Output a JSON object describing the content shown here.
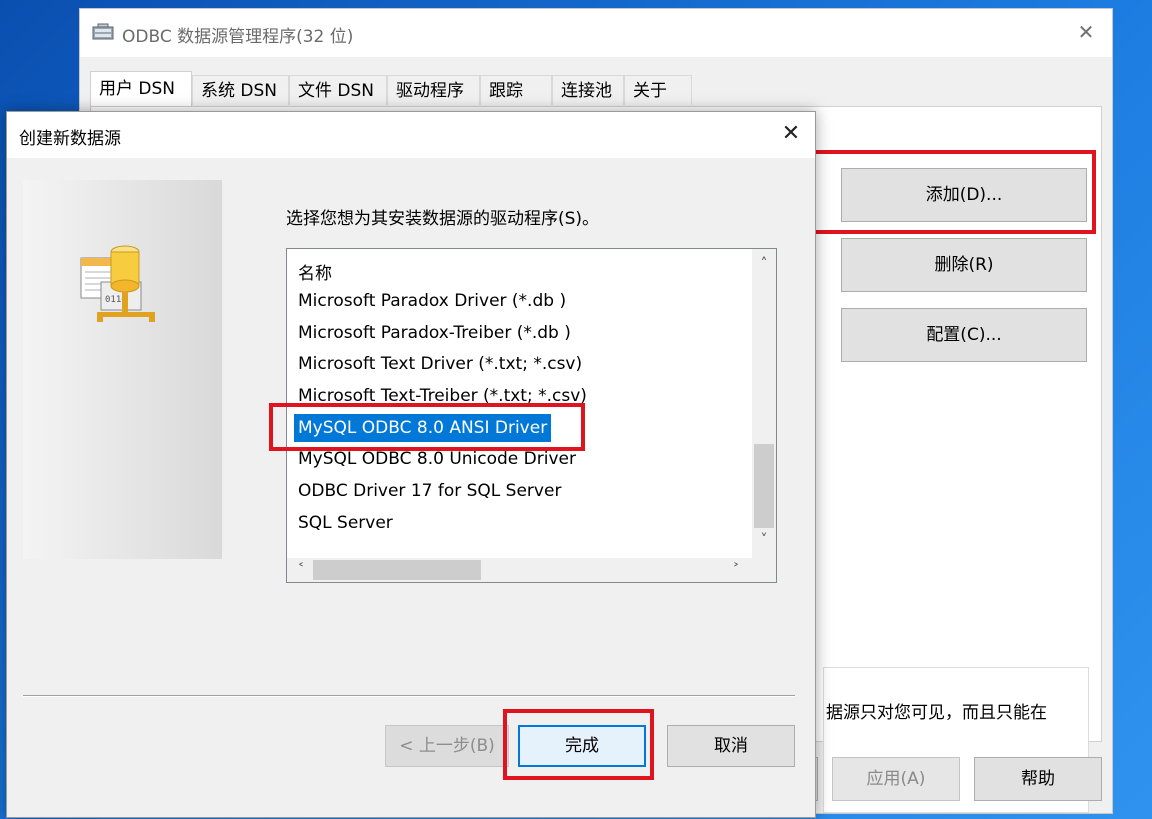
{
  "main_window": {
    "title": "ODBC 数据源管理程序(32 位)",
    "close_glyph": "✕",
    "tabs": [
      {
        "label": "用户 DSN"
      },
      {
        "label": "系统 DSN"
      },
      {
        "label": "文件 DSN"
      },
      {
        "label": "驱动程序"
      },
      {
        "label": "跟踪"
      },
      {
        "label": "连接池"
      },
      {
        "label": "关于"
      }
    ],
    "active_tab": "用户 DSN",
    "buttons": {
      "add": "添加(D)...",
      "remove": "删除(R)",
      "configure": "配置(C)..."
    },
    "description": "据源只对您可见，而且只能在",
    "bottom_buttons": {
      "ok": "",
      "cancel": "",
      "apply": "应用(A)",
      "help": "帮助"
    }
  },
  "dialog": {
    "title": "创建新数据源",
    "close_glyph": "✕",
    "prompt": "选择您想为其安装数据源的驱动程序(S)。",
    "list": {
      "header": "名称",
      "items": [
        "Microsoft Paradox Driver (*.db )",
        "Microsoft Paradox-Treiber (*.db )",
        "Microsoft Text Driver (*.txt; *.csv)",
        "Microsoft Text-Treiber (*.txt; *.csv)",
        "MySQL ODBC 8.0 ANSI Driver",
        "MySQL ODBC 8.0 Unicode Driver",
        "ODBC Driver 17 for SQL Server",
        "SQL Server"
      ],
      "selected": "MySQL ODBC 8.0 ANSI Driver"
    },
    "buttons": {
      "back": "< 上一步(B)",
      "finish": "完成",
      "cancel": "取消"
    }
  },
  "icons": {
    "app": "odbc-app-icon",
    "database": "database-driver-icon",
    "close": "close-icon",
    "scroll_up": "chevron-up-icon",
    "scroll_down": "chevron-down-icon",
    "scroll_left": "chevron-left-icon",
    "scroll_right": "chevron-right-icon"
  },
  "colors": {
    "selection": "#0078d7",
    "highlight_annotation": "#e0141e",
    "default_button_border": "#0078d7"
  }
}
